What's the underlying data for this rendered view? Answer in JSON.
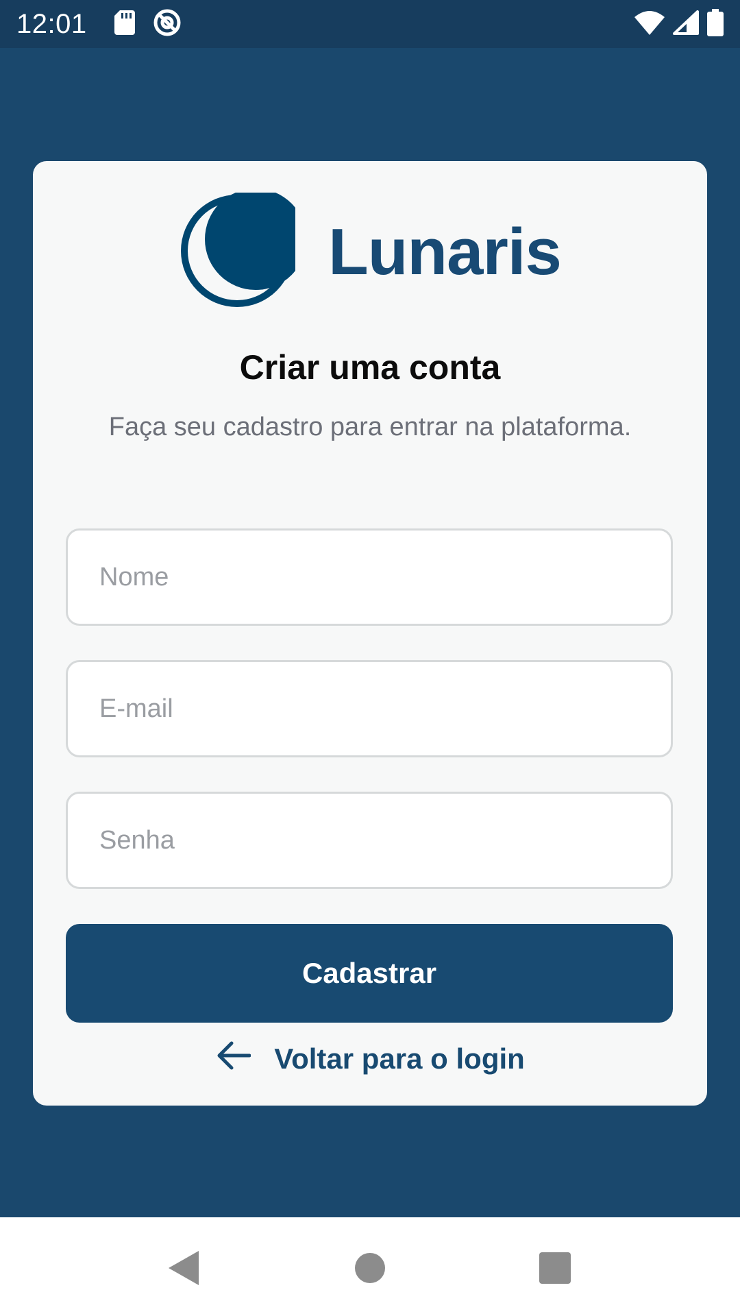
{
  "status_bar": {
    "time": "12:01",
    "icons": [
      "sd-card-icon",
      "at-sign-icon",
      "wifi-icon",
      "signal-icon",
      "battery-icon"
    ]
  },
  "brand": {
    "name": "Lunaris",
    "logo_icon": "crescent-moon-icon",
    "color": "#184a74"
  },
  "signup": {
    "heading": "Criar uma conta",
    "subtitle": "Faça seu cadastro para entrar na plataforma.",
    "fields": {
      "name_placeholder": "Nome",
      "email_placeholder": "E-mail",
      "password_placeholder": "Senha"
    },
    "submit_label": "Cadastrar",
    "back_label": "Voltar para o login",
    "back_icon": "arrow-left-icon"
  },
  "navigation_bar": {
    "buttons": [
      "back-icon",
      "home-icon",
      "recents-icon"
    ]
  },
  "colors": {
    "background": "#1a486d",
    "status_bar": "#173d5e",
    "card": "#f7f8f8",
    "primary": "#184a71"
  }
}
